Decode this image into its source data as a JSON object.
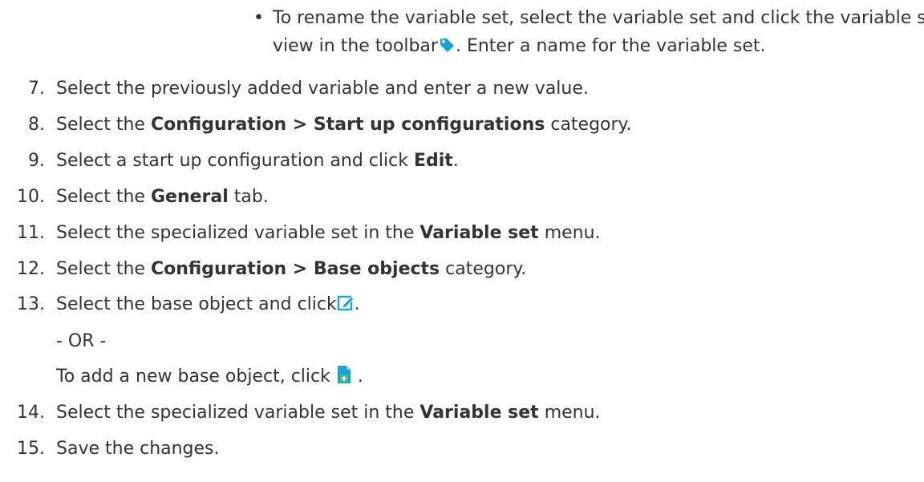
{
  "bullet_item": {
    "bullet": "•",
    "line1": "To rename the variable set, select the variable set and click the variable set",
    "line2_before": "view in the toolbar",
    "line2_after": ". Enter a name for the variable set.",
    "icon": "tag-icon"
  },
  "steps": [
    {
      "num": "7.",
      "pre": "Select the previously added variable and enter a new value.",
      "bold": "",
      "post": ""
    },
    {
      "num": "8.",
      "pre": "Select the ",
      "bold": "Configuration > Start up configurations",
      "post": " category."
    },
    {
      "num": "9.",
      "pre": "Select a start up configuration and click ",
      "bold": "Edit",
      "post": "."
    },
    {
      "num": "10.",
      "pre": "Select the ",
      "bold": "General",
      "post": " tab."
    },
    {
      "num": "11.",
      "pre": "Select the specialized variable set in the ",
      "bold": "Variable set",
      "post": " menu."
    },
    {
      "num": "12.",
      "pre": "Select the ",
      "bold": "Configuration > Base objects",
      "post": " category."
    },
    {
      "num": "13.",
      "pre": "Select the base object and click",
      "bold": "",
      "post": ".",
      "icon": "edit-icon"
    },
    {
      "num": "14.",
      "pre": "Select the specialized variable set in the ",
      "bold": "Variable set",
      "post": " menu."
    },
    {
      "num": "15.",
      "pre": "Save the changes.",
      "bold": "",
      "post": ""
    }
  ],
  "or_text": "- OR -",
  "alt_text_pre": "To add a new base object, click",
  "alt_text_post": " .",
  "alt_icon": "add-document-icon",
  "icon_color": "#1aa3d9"
}
